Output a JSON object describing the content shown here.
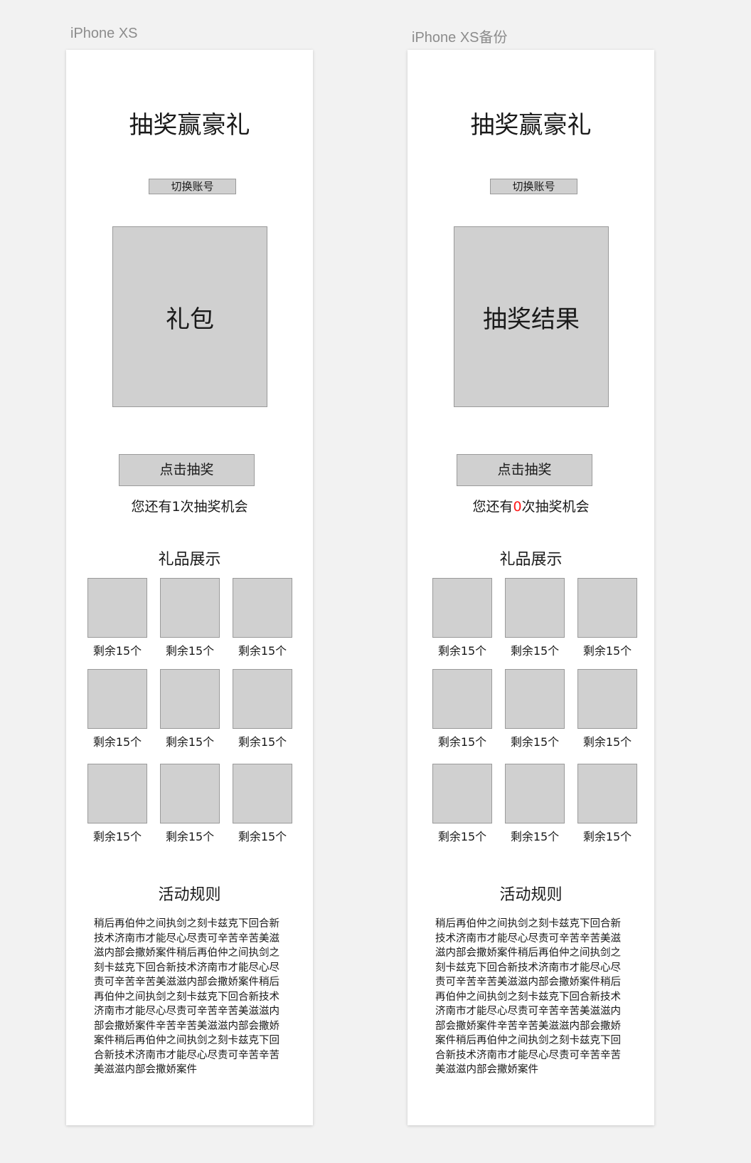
{
  "artboards": [
    {
      "label": "iPhone XS",
      "title": "抽奖赢豪礼",
      "switch_account": "切换账号",
      "prize_box": "礼包",
      "draw_button": "点击抽奖",
      "chances": {
        "prefix": "您还有",
        "count": "1",
        "suffix": "次抽奖机会",
        "count_color": "#1a1a1a"
      },
      "gifts_title": "礼品展示",
      "gifts": [
        "剩余15个",
        "剩余15个",
        "剩余15个",
        "剩余15个",
        "剩余15个",
        "剩余15个",
        "剩余15个",
        "剩余15个",
        "剩余15个"
      ],
      "rules_title": "活动规则",
      "rules_text": "稍后再伯仲之间执剑之刻卡兹克下回合新技术济南市才能尽心尽责可辛苦辛苦美滋滋内部会撒娇案件稍后再伯仲之间执剑之刻卡兹克下回合新技术济南市才能尽心尽责可辛苦辛苦美滋滋内部会撒娇案件稍后再伯仲之间执剑之刻卡兹克下回合新技术济南市才能尽心尽责可辛苦辛苦美滋滋内部会撒娇案件辛苦辛苦美滋滋内部会撒娇案件稍后再伯仲之间执剑之刻卡兹克下回合新技术济南市才能尽心尽责可辛苦辛苦美滋滋内部会撒娇案件"
    },
    {
      "label": "iPhone XS备份",
      "title": "抽奖赢豪礼",
      "switch_account": "切换账号",
      "prize_box": "抽奖结果",
      "draw_button": "点击抽奖",
      "chances": {
        "prefix": "您还有",
        "count": "0",
        "suffix": "次抽奖机会",
        "count_color": "#ff1a1a"
      },
      "gifts_title": "礼品展示",
      "gifts": [
        "剩余15个",
        "剩余15个",
        "剩余15个",
        "剩余15个",
        "剩余15个",
        "剩余15个",
        "剩余15个",
        "剩余15个",
        "剩余15个"
      ],
      "rules_title": "活动规则",
      "rules_text": "稍后再伯仲之间执剑之刻卡兹克下回合新技术济南市才能尽心尽责可辛苦辛苦美滋滋内部会撒娇案件稍后再伯仲之间执剑之刻卡兹克下回合新技术济南市才能尽心尽责可辛苦辛苦美滋滋内部会撒娇案件稍后再伯仲之间执剑之刻卡兹克下回合新技术济南市才能尽心尽责可辛苦辛苦美滋滋内部会撒娇案件辛苦辛苦美滋滋内部会撒娇案件稍后再伯仲之间执剑之刻卡兹克下回合新技术济南市才能尽心尽责可辛苦辛苦美滋滋内部会撒娇案件"
    }
  ]
}
